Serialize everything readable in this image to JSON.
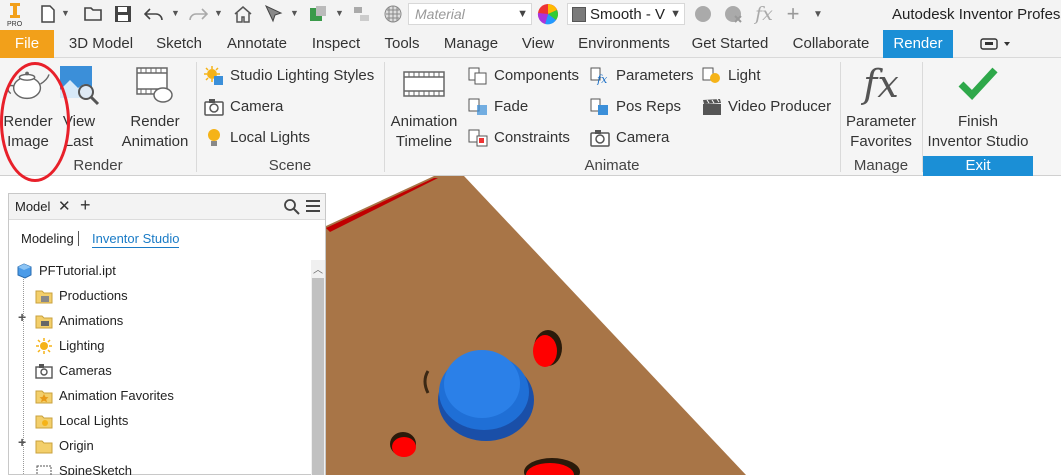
{
  "app": {
    "title": "Autodesk Inventor Profess",
    "logo_text": "PRO"
  },
  "qat": {
    "material_placeholder": "Material",
    "appearance_value": "Smooth - V",
    "icons": [
      "new-icon",
      "open-icon",
      "save-icon",
      "undo-icon",
      "redo-icon",
      "home-icon",
      "select-icon",
      "update-icon",
      "measure-icon",
      "material-icon",
      "color-wheel-icon",
      "appearance-icon",
      "clear-appearance-icon",
      "fx-icon",
      "plus-icon",
      "customize-icon"
    ]
  },
  "tabs": [
    {
      "label": "File"
    },
    {
      "label": "3D Model"
    },
    {
      "label": "Sketch"
    },
    {
      "label": "Annotate"
    },
    {
      "label": "Inspect"
    },
    {
      "label": "Tools"
    },
    {
      "label": "Manage"
    },
    {
      "label": "View"
    },
    {
      "label": "Environments"
    },
    {
      "label": "Get Started"
    },
    {
      "label": "Collaborate"
    },
    {
      "label": "Render"
    }
  ],
  "ribbon": {
    "render": {
      "title": "Render",
      "render_image": "Render\nImage",
      "render_image_l1": "Render",
      "render_image_l2": "Image",
      "view_last_l1": "View",
      "view_last_l2": "Last",
      "render_animation_l1": "Render",
      "render_animation_l2": "Animation"
    },
    "scene": {
      "title": "Scene",
      "studio_lighting": "Studio Lighting Styles",
      "camera": "Camera",
      "local_lights": "Local Lights"
    },
    "animate": {
      "title": "Animate",
      "timeline_l1": "Animation",
      "timeline_l2": "Timeline",
      "components": "Components",
      "fade": "Fade",
      "constraints": "Constraints",
      "parameters": "Parameters",
      "pos_reps": "Pos Reps",
      "camera": "Camera",
      "light": "Light",
      "video_producer": "Video Producer"
    },
    "manage": {
      "title": "Manage",
      "param_fav_l1": "Parameter",
      "param_fav_l2": "Favorites"
    },
    "exit": {
      "title": "Exit",
      "finish_l1": "Finish",
      "finish_l2": "Inventor Studio"
    }
  },
  "browser": {
    "tab": "Model",
    "subtab_modeling": "Modeling",
    "subtab_studio": "Inventor Studio",
    "tree": [
      {
        "label": "PFTutorial.ipt"
      },
      {
        "label": "Productions"
      },
      {
        "label": "Animations"
      },
      {
        "label": "Lighting"
      },
      {
        "label": "Cameras"
      },
      {
        "label": "Animation Favorites"
      },
      {
        "label": "Local Lights"
      },
      {
        "label": "Origin"
      },
      {
        "label": "SpineSketch"
      }
    ]
  },
  "colors": {
    "file_tab": "#f2a01a",
    "active_tab": "#1b8fd6",
    "part_brown": "#a87547",
    "hole_red": "#ff0000",
    "knob_blue": "#1f6fd6",
    "annotation_circle": "#e8202a"
  }
}
